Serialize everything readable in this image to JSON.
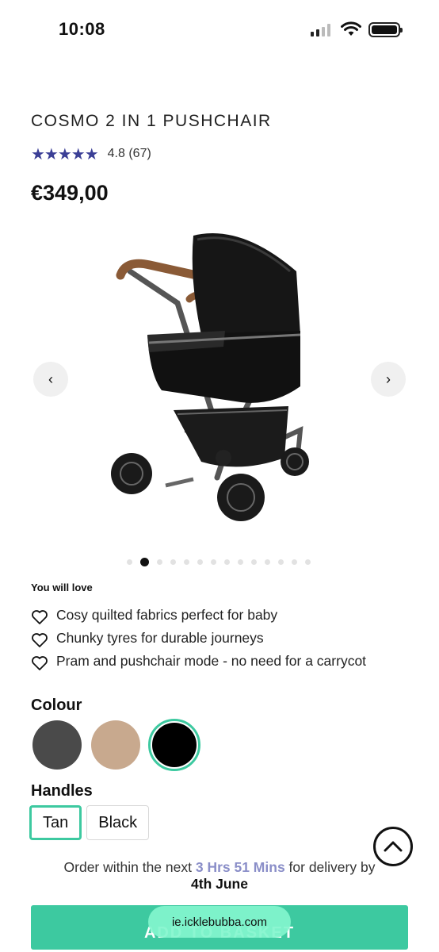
{
  "status_bar": {
    "time": "10:08"
  },
  "product": {
    "title": "COSMO 2 IN 1 PUSHCHAIR",
    "stars": "★★★★★",
    "rating_text": "4.8 (67)",
    "price": "€349,00"
  },
  "gallery": {
    "prev_icon": "‹",
    "next_icon": "›",
    "image_count": 14,
    "active_index": 1
  },
  "features": {
    "heading": "You will love",
    "items": [
      "Cosy quilted fabrics perfect for baby",
      "Chunky tyres for durable journeys",
      "Pram and pushchair mode - no need for a carrycot"
    ]
  },
  "colour": {
    "label": "Colour",
    "options": [
      {
        "color": "#4a4a4a",
        "selected": false
      },
      {
        "color": "#c8a98e",
        "selected": false
      },
      {
        "color": "#000000",
        "selected": true
      }
    ]
  },
  "handles": {
    "label": "Handles",
    "options": [
      {
        "label": "Tan",
        "selected": true
      },
      {
        "label": "Black",
        "selected": false
      }
    ]
  },
  "delivery": {
    "prefix": "Order within the next ",
    "countdown": "3 Hrs 51 Mins",
    "suffix": " for delivery by",
    "date": "4th June"
  },
  "cta": {
    "label": "ADD TO BASKET"
  },
  "browser": {
    "url": "ie.icklebubba.com"
  },
  "colors": {
    "accent": "#3dc9a0",
    "stars": "#3b3f96",
    "countdown": "#8a8ec8"
  }
}
